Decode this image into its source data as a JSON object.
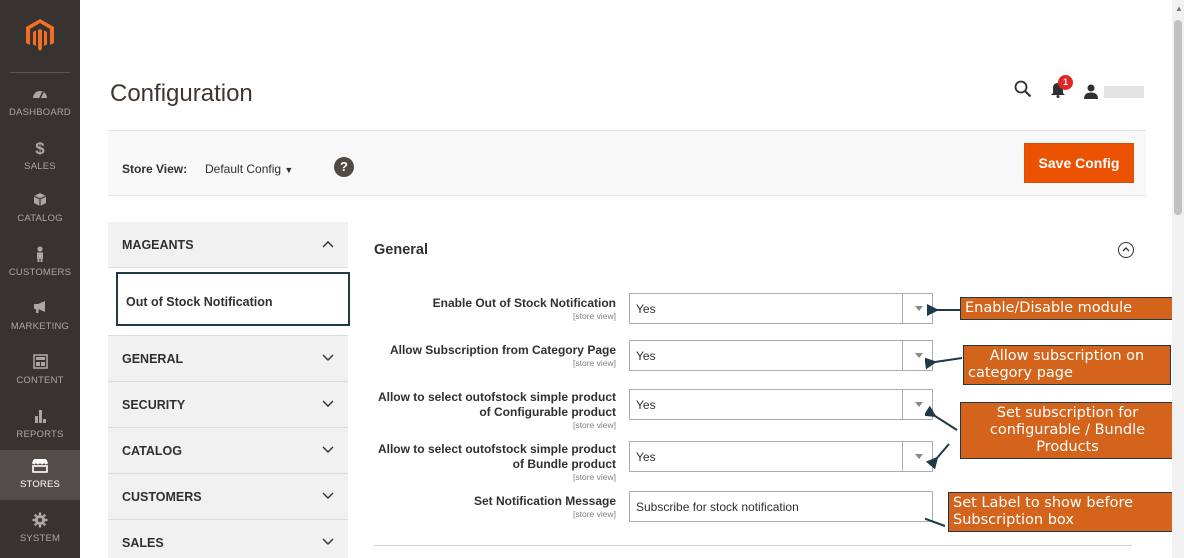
{
  "sidebar": {
    "items": [
      {
        "label": "DASHBOARD",
        "icon": "dashboard-icon"
      },
      {
        "label": "SALES",
        "icon": "dollar-icon"
      },
      {
        "label": "CATALOG",
        "icon": "box-icon"
      },
      {
        "label": "CUSTOMERS",
        "icon": "person-icon"
      },
      {
        "label": "MARKETING",
        "icon": "megaphone-icon"
      },
      {
        "label": "CONTENT",
        "icon": "layout-icon"
      },
      {
        "label": "REPORTS",
        "icon": "bar-chart-icon"
      },
      {
        "label": "STORES",
        "icon": "store-icon"
      },
      {
        "label": "SYSTEM",
        "icon": "gear-icon"
      }
    ]
  },
  "header": {
    "title": "Configuration",
    "notification_count": "1"
  },
  "store_bar": {
    "label": "Store View:",
    "value": "Default Config",
    "help": "?",
    "save_label": "Save Config"
  },
  "config_nav": {
    "mageants": "MAGEANTS",
    "sub_item": "Out of Stock Notification",
    "groups": [
      "GENERAL",
      "SECURITY",
      "CATALOG",
      "CUSTOMERS",
      "SALES"
    ]
  },
  "section": {
    "title": "General",
    "scope": "[store view]",
    "fields": [
      {
        "label": "Enable Out of Stock Notification",
        "value": "Yes"
      },
      {
        "label": "Allow Subscription from Category Page",
        "value": "Yes"
      },
      {
        "label_line1": "Allow to select outofstock simple product",
        "label_line2": "of Configurable product",
        "value": "Yes"
      },
      {
        "label_line1": "Allow to select outofstock simple product",
        "label_line2": "of Bundle product",
        "value": "Yes"
      },
      {
        "label": "Set Notification Message",
        "value": "Subscribe for stock notification"
      }
    ]
  },
  "annotations": {
    "a1": "Enable/Disable module",
    "a2_l1": "Allow subscription on",
    "a2_l2": "category page",
    "a3_l1": "Set subscription for",
    "a3_l2": "configurable / Bundle",
    "a3_l3": "Products",
    "a4_l1": "Set Label to show before",
    "a4_l2": "Subscription box"
  },
  "colors": {
    "accent": "#eb5202",
    "sidebar": "#373330",
    "annotation": "#d4641c"
  }
}
